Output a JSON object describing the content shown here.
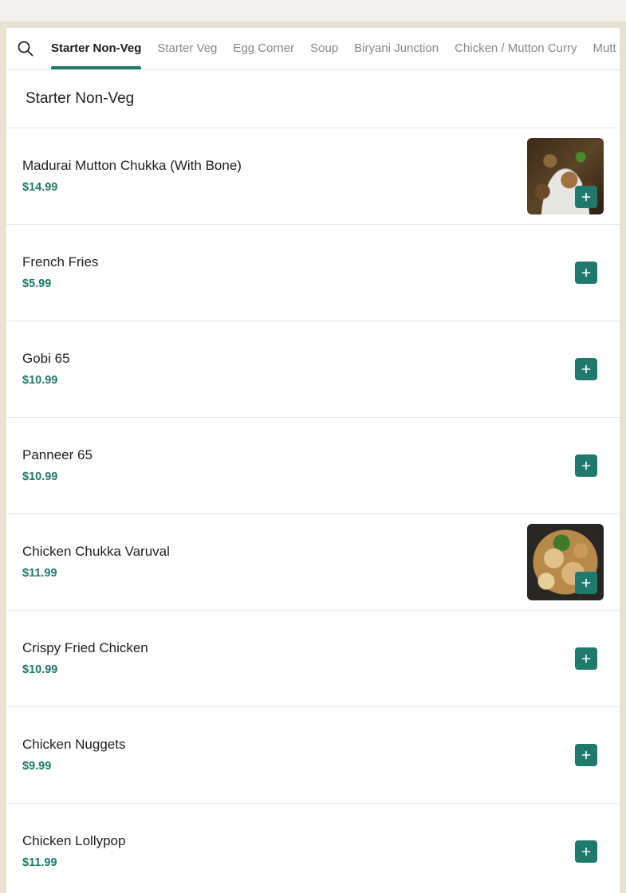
{
  "tabs": [
    {
      "label": "Starter Non-Veg",
      "active": true
    },
    {
      "label": "Starter Veg",
      "active": false
    },
    {
      "label": "Egg Corner",
      "active": false
    },
    {
      "label": "Soup",
      "active": false
    },
    {
      "label": "Biryani Junction",
      "active": false
    },
    {
      "label": "Chicken / Mutton Curry",
      "active": false
    },
    {
      "label": "Mutt",
      "active": false
    }
  ],
  "section": {
    "title": "Starter Non-Veg"
  },
  "items": [
    {
      "name": "Madurai Mutton Chukka (With Bone)",
      "price": "$14.99",
      "image": "mutton-chukka-photo"
    },
    {
      "name": "French Fries",
      "price": "$5.99",
      "image": ""
    },
    {
      "name": "Gobi 65",
      "price": "$10.99",
      "image": ""
    },
    {
      "name": "Panneer 65",
      "price": "$10.99",
      "image": ""
    },
    {
      "name": "Chicken Chukka Varuval",
      "price": "$11.99",
      "image": "chicken-chukka-photo"
    },
    {
      "name": "Crispy Fried Chicken",
      "price": "$10.99",
      "image": ""
    },
    {
      "name": "Chicken Nuggets",
      "price": "$9.99",
      "image": ""
    },
    {
      "name": "Chicken Lollypop",
      "price": "$11.99",
      "image": ""
    }
  ],
  "icons": {
    "search": "search-icon",
    "add": "plus-icon"
  },
  "colors": {
    "accent": "#1f7a6b",
    "page_background": "#e9e2d3",
    "top_strip": "#f4f1ec"
  }
}
